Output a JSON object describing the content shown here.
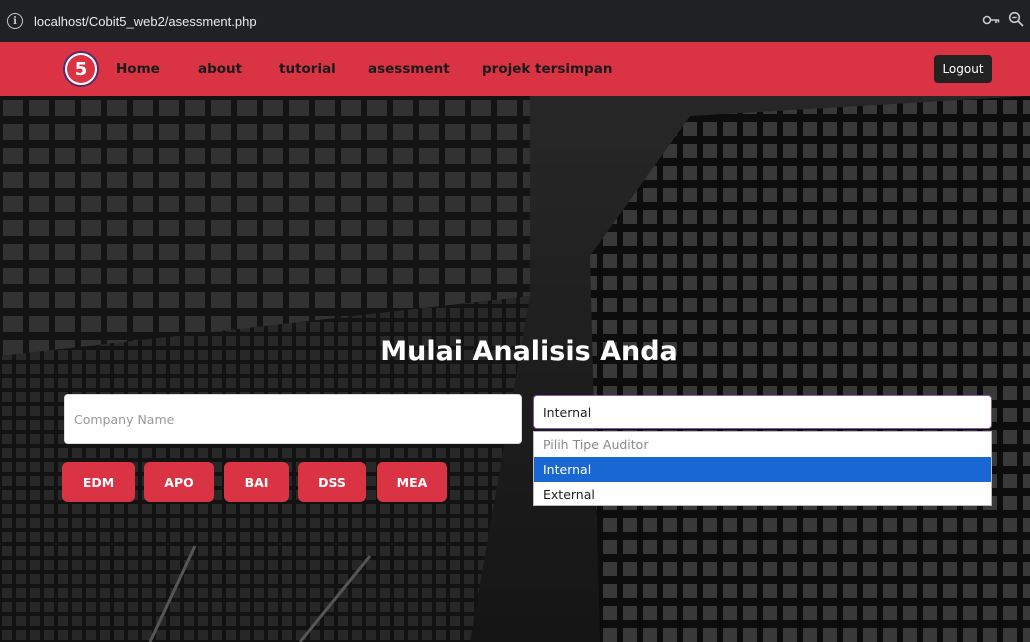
{
  "browser": {
    "url": "localhost/Cobit5_web2/asessment.php"
  },
  "navbar": {
    "logo_text": "5",
    "links": [
      "Home",
      "about",
      "tutorial",
      "asessment",
      "projek tersimpan"
    ],
    "logout_label": "Logout"
  },
  "hero": {
    "title": "Mulai Analisis Anda",
    "company_placeholder": "Company Name",
    "auditor_select": {
      "selected": "Internal",
      "options": [
        "Pilih Tipe Auditor",
        "Internal",
        "External"
      ]
    },
    "domain_buttons": [
      "EDM",
      "APO",
      "BAI",
      "DSS",
      "MEA"
    ]
  },
  "colors": {
    "accent": "#d93344",
    "selected_option": "#1967d2"
  }
}
